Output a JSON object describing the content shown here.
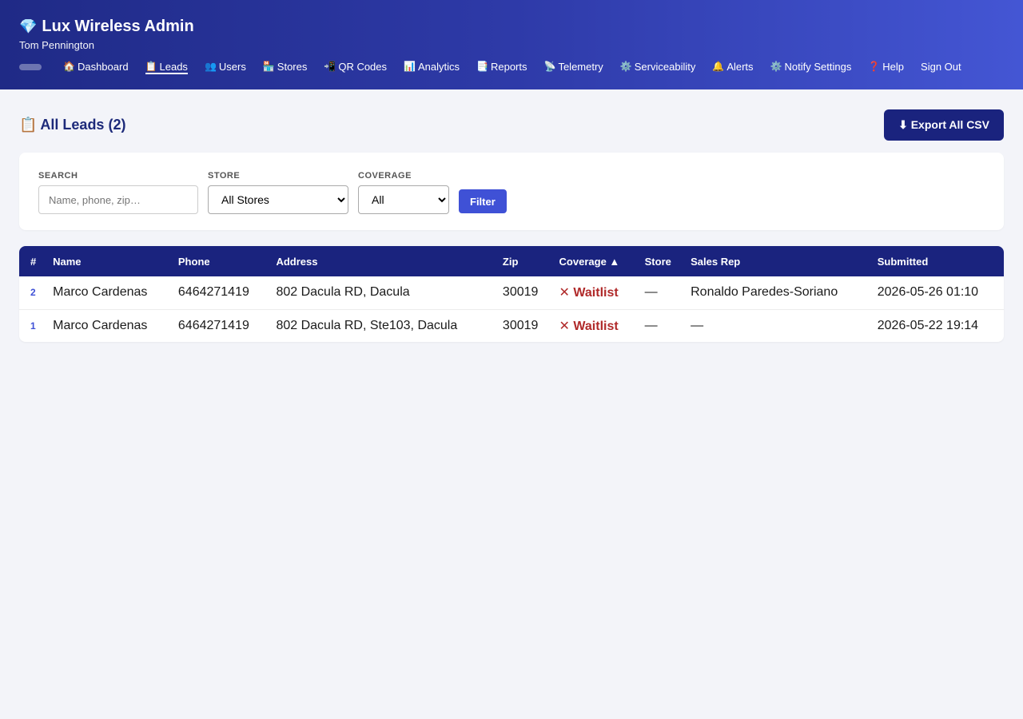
{
  "header": {
    "app_icon": "💎",
    "app_title": "Lux Wireless Admin",
    "user_name": "Tom Pennington"
  },
  "nav": [
    {
      "icon": "🏠",
      "label": "Dashboard",
      "active": false
    },
    {
      "icon": "📋",
      "label": "Leads",
      "active": true
    },
    {
      "icon": "👥",
      "label": "Users",
      "active": false
    },
    {
      "icon": "🏪",
      "label": "Stores",
      "active": false
    },
    {
      "icon": "📲",
      "label": "QR Codes",
      "active": false
    },
    {
      "icon": "📊",
      "label": "Analytics",
      "active": false
    },
    {
      "icon": "📑",
      "label": "Reports",
      "active": false
    },
    {
      "icon": "📡",
      "label": "Telemetry",
      "active": false
    },
    {
      "icon": "⚙️",
      "label": "Serviceability",
      "active": false
    },
    {
      "icon": "🔔",
      "label": "Alerts",
      "active": false
    },
    {
      "icon": "⚙️",
      "label": "Notify Settings",
      "active": false
    },
    {
      "icon": "❓",
      "label": "Help",
      "active": false
    },
    {
      "icon": "",
      "label": "Sign Out",
      "active": false
    }
  ],
  "page": {
    "title_icon": "📋",
    "title": "All Leads (2)",
    "export_label": "⬇ Export All CSV"
  },
  "filters": {
    "search_label": "SEARCH",
    "search_placeholder": "Name, phone, zip…",
    "search_value": "",
    "store_label": "STORE",
    "store_selected": "All Stores",
    "coverage_label": "COVERAGE",
    "coverage_selected": "All",
    "filter_button": "Filter"
  },
  "table": {
    "columns": [
      "#",
      "Name",
      "Phone",
      "Address",
      "Zip",
      "Coverage ▲",
      "Store",
      "Sales Rep",
      "Submitted"
    ],
    "rows": [
      [
        "2",
        "Marco Cardenas",
        "6464271419",
        "802 Dacula RD, Dacula",
        "30019",
        "✕ Waitlist",
        "—",
        "Ronaldo Paredes-Soriano",
        "2026-05-26 01:10"
      ],
      [
        "1",
        "Marco Cardenas",
        "6464271419",
        "802 Dacula RD, Ste103, Dacula",
        "30019",
        "✕ Waitlist",
        "—",
        "—",
        "2026-05-22 19:14"
      ]
    ]
  },
  "colors": {
    "header_gradient_start": "#1f2a86",
    "header_gradient_end": "#4456d4",
    "table_header": "#1a237e",
    "accent": "#3f51d6",
    "waitlist": "#b02a2a"
  }
}
